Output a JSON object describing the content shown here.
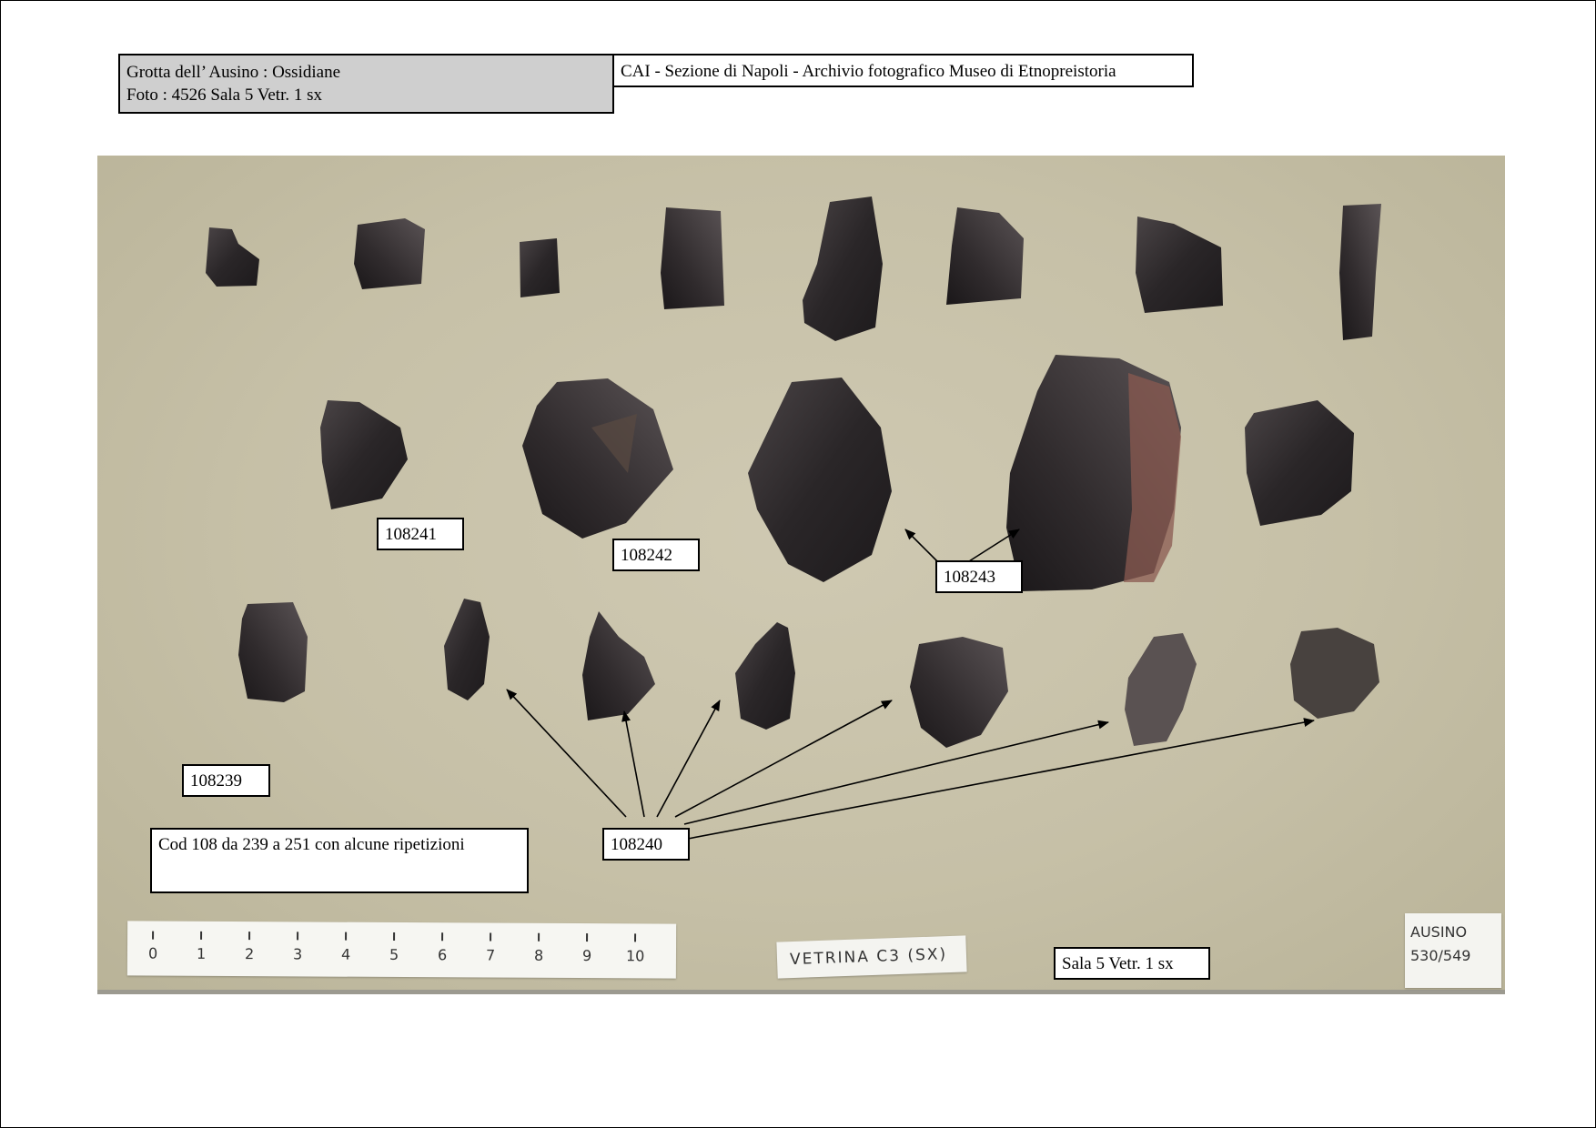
{
  "header": {
    "left_line1": "Grotta dell’ Ausino  :  Ossidiane",
    "left_line2": "Foto :  4526    Sala  5    Vetr.  1 sx",
    "right": "CAI - Sezione di Napoli  - Archivio fotografico Museo di Etnopreistoria"
  },
  "labels": {
    "l108241": "108241",
    "l108242": "108242",
    "l108243": "108243",
    "l108239": "108239",
    "l108240": "108240",
    "cod_note": "Cod 108 da 239 a 251 con alcune ripetizioni",
    "sala": "Sala 5  Vetr. 1 sx"
  },
  "ruler": {
    "numbers": [
      "0",
      "1",
      "2",
      "3",
      "4",
      "5",
      "6",
      "7",
      "8",
      "9",
      "10"
    ]
  },
  "cards": {
    "vetrina": "VETRINA C3 (SX)",
    "ausino_line1": "AUSINO",
    "ausino_line2": "530/549"
  },
  "colors": {
    "background_card": "#c6c0a7",
    "obsidian": "#2e2a2c",
    "header_grey": "#cfcfcf"
  }
}
